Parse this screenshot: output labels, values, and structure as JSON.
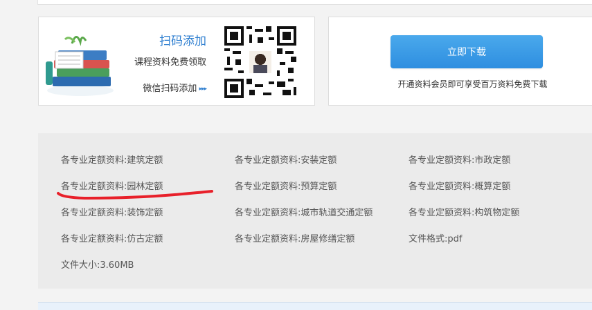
{
  "qr_card": {
    "title": "扫码添加",
    "subtitle": "课程资料免费领取",
    "scan_label": "微信扫码添加",
    "arrow_glyph": "▸▸▸"
  },
  "download_card": {
    "button_label": "立即下载",
    "note": "开通资料会员即可享受百万资料免费下载"
  },
  "info": {
    "items": [
      "各专业定额资料:建筑定额",
      "各专业定额资料:安装定额",
      "各专业定额资料:市政定额",
      "各专业定额资料:园林定额",
      "各专业定额资料:预算定额",
      "各专业定额资料:概算定额",
      "各专业定额资料:装饰定额",
      "各专业定额资料:城市轨道交通定额",
      "各专业定额资料:构筑物定额",
      "各专业定额资料:仿古定额",
      "各专业定额资料:房屋修缮定额",
      "文件格式:pdf",
      "文件大小:3.60MB"
    ]
  },
  "colors": {
    "accent": "#2f7fd0",
    "button": "#3a9be6",
    "annotation": "#e8202a"
  }
}
